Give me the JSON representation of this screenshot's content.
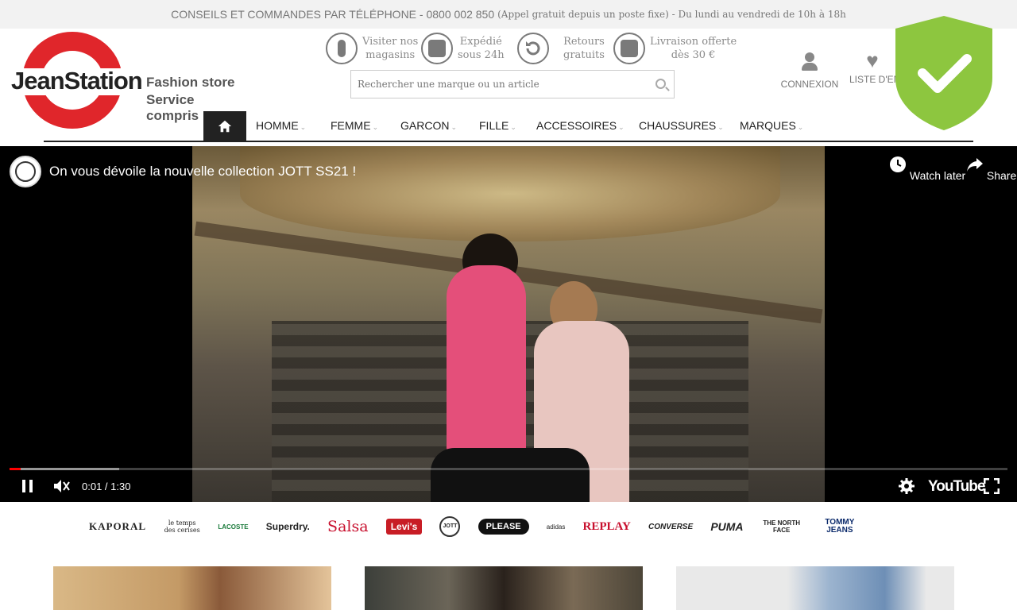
{
  "topbar": {
    "main": "CONSEILS ET COMMANDES PAR TÉLÉPHONE - 0800 002 850",
    "small": "(Appel gratuit depuis un poste fixe) - Du lundi au vendredi de 10h à 18h"
  },
  "logo": {
    "brand": "JeanStation",
    "tagline1": "Fashion store",
    "tagline2": "Service compris"
  },
  "features": [
    {
      "line1": "Visiter nos",
      "line2": "magasins",
      "icon": "store-person-icon"
    },
    {
      "line1": "Expédié",
      "line2": "sous 24h",
      "icon": "truck-clock-icon"
    },
    {
      "line1": "Retours",
      "line2": "gratuits",
      "icon": "return-arrow-icon"
    },
    {
      "line1": "Livraison offerte",
      "line2": "dès 30 €",
      "icon": "truck-euro-icon"
    }
  ],
  "search": {
    "placeholder": "Rechercher une marque ou un article"
  },
  "account": {
    "login_label": "CONNEXION",
    "wishlist_label": "LISTE D'EN"
  },
  "nav": {
    "items": [
      "HOMME",
      "FEMME",
      "GARCON",
      "FILLE",
      "ACCESSOIRES",
      "CHAUSSURES",
      "MARQUES"
    ]
  },
  "video": {
    "title": "On vous dévoile la nouvelle collection JOTT SS21 !",
    "watch_later": "Watch later",
    "share": "Share",
    "time": "0:01 / 1:30",
    "youtube": "YouTube",
    "progress_played_fraction": 0.011,
    "progress_buffered_fraction": 0.11
  },
  "brands": [
    "KAPORAL",
    "le temps des cerises",
    "LACOSTE",
    "Superdry.",
    "Salsa",
    "Levi's",
    "JOTT",
    "PLEASE",
    "adidas",
    "REPLAY",
    "CONVERSE",
    "PUMA",
    "THE NORTH FACE",
    "TOMMY JEANS"
  ],
  "colors": {
    "accent_red": "#e0262b",
    "shield_green": "#8dc63f",
    "nav_dark": "#222222"
  }
}
